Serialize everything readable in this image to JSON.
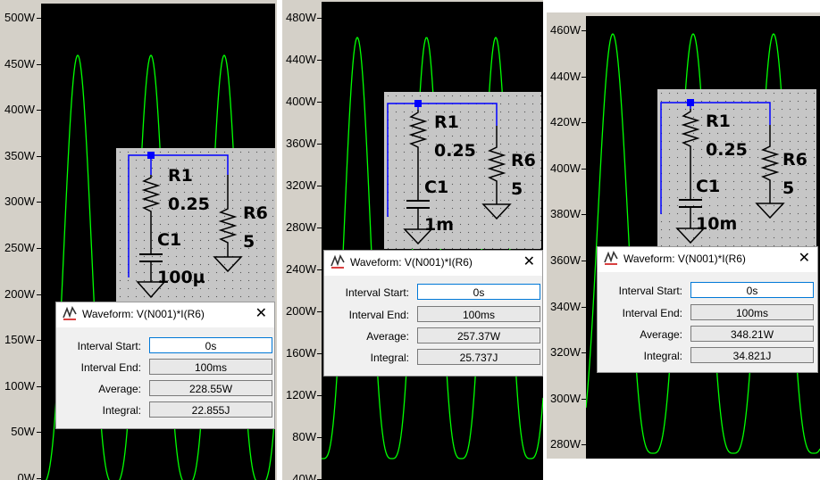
{
  "colors": {
    "plot_background": "#000000",
    "trace": "#00ff00",
    "schematic_wire": "#0000ff",
    "schematic_bg": "#c6c6c6",
    "node_marker": "#0000ff"
  },
  "panels": [
    {
      "y_ticks": [
        "500W",
        "450W",
        "400W",
        "350W",
        "300W",
        "250W",
        "200W",
        "150W",
        "100W",
        "50W",
        "0W"
      ],
      "schematic": {
        "r1_name": "R1",
        "r1_value": "0.25",
        "c1_name": "C1",
        "c1_value": "100µ",
        "r6_name": "R6",
        "r6_value": "5"
      },
      "dialog": {
        "title": "Waveform: V(N001)*I(R6)",
        "close_glyph": "✕",
        "interval_start_label": "Interval Start:",
        "interval_start": "0s",
        "interval_end_label": "Interval End:",
        "interval_end": "100ms",
        "average_label": "Average:",
        "average": "228.55W",
        "integral_label": "Integral:",
        "integral": "22.855J"
      }
    },
    {
      "y_ticks": [
        "480W",
        "440W",
        "400W",
        "360W",
        "320W",
        "280W",
        "240W",
        "200W",
        "160W",
        "120W",
        "80W",
        "40W"
      ],
      "schematic": {
        "r1_name": "R1",
        "r1_value": "0.25",
        "c1_name": "C1",
        "c1_value": "1m",
        "r6_name": "R6",
        "r6_value": "5"
      },
      "dialog": {
        "title": "Waveform: V(N001)*I(R6)",
        "close_glyph": "✕",
        "interval_start_label": "Interval Start:",
        "interval_start": "0s",
        "interval_end_label": "Interval End:",
        "interval_end": "100ms",
        "average_label": "Average:",
        "average": "257.37W",
        "integral_label": "Integral:",
        "integral": "25.737J"
      }
    },
    {
      "y_ticks": [
        "460W",
        "440W",
        "420W",
        "400W",
        "380W",
        "360W",
        "340W",
        "320W",
        "300W",
        "280W"
      ],
      "schematic": {
        "r1_name": "R1",
        "r1_value": "0.25",
        "c1_name": "C1",
        "c1_value": "10m",
        "r6_name": "R6",
        "r6_value": "5"
      },
      "dialog": {
        "title": "Waveform: V(N001)*I(R6)",
        "close_glyph": "✕",
        "interval_start_label": "Interval Start:",
        "interval_start": "0s",
        "interval_end_label": "Interval End:",
        "interval_end": "100ms",
        "average_label": "Average:",
        "average": "348.21W",
        "integral_label": "Integral:",
        "integral": "34.821J"
      }
    }
  ]
}
